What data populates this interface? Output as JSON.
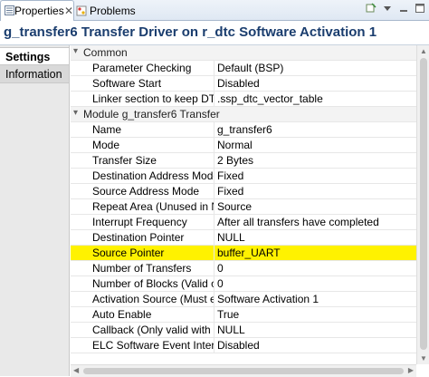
{
  "tabs": {
    "properties": "Properties",
    "problems": "Problems",
    "close": "✕"
  },
  "title": "g_transfer6 Transfer Driver on r_dtc Software Activation 1",
  "left_tabs": [
    "Settings",
    "Information"
  ],
  "categories": {
    "common": "Common",
    "module": "Module g_transfer6 Transfer"
  },
  "common_rows": [
    {
      "key": "Parameter Checking",
      "value": "Default (BSP)"
    },
    {
      "key": "Software Start",
      "value": "Disabled"
    },
    {
      "key": "Linker section to keep DTC",
      "value": ".ssp_dtc_vector_table"
    }
  ],
  "module_rows": [
    {
      "key": "Name",
      "value": "g_transfer6"
    },
    {
      "key": "Mode",
      "value": "Normal"
    },
    {
      "key": "Transfer Size",
      "value": "2 Bytes"
    },
    {
      "key": "Destination Address Mode",
      "value": "Fixed"
    },
    {
      "key": "Source Address Mode",
      "value": "Fixed"
    },
    {
      "key": "Repeat Area (Unused in Normal",
      "value": "Source"
    },
    {
      "key": "Interrupt Frequency",
      "value": "After all transfers have completed"
    },
    {
      "key": "Destination Pointer",
      "value": "NULL"
    },
    {
      "key": "Source Pointer",
      "value": "buffer_UART"
    },
    {
      "key": "Number of Transfers",
      "value": "0"
    },
    {
      "key": "Number of Blocks (Valid only",
      "value": "0"
    },
    {
      "key": "Activation Source (Must enable",
      "value": "Software Activation 1"
    },
    {
      "key": "Auto Enable",
      "value": "True"
    },
    {
      "key": "Callback (Only valid with Software",
      "value": "NULL"
    },
    {
      "key": "ELC Software Event Interrupt",
      "value": "Disabled"
    }
  ],
  "highlight_color": "#fff200",
  "title_color": "#1a3d6e"
}
